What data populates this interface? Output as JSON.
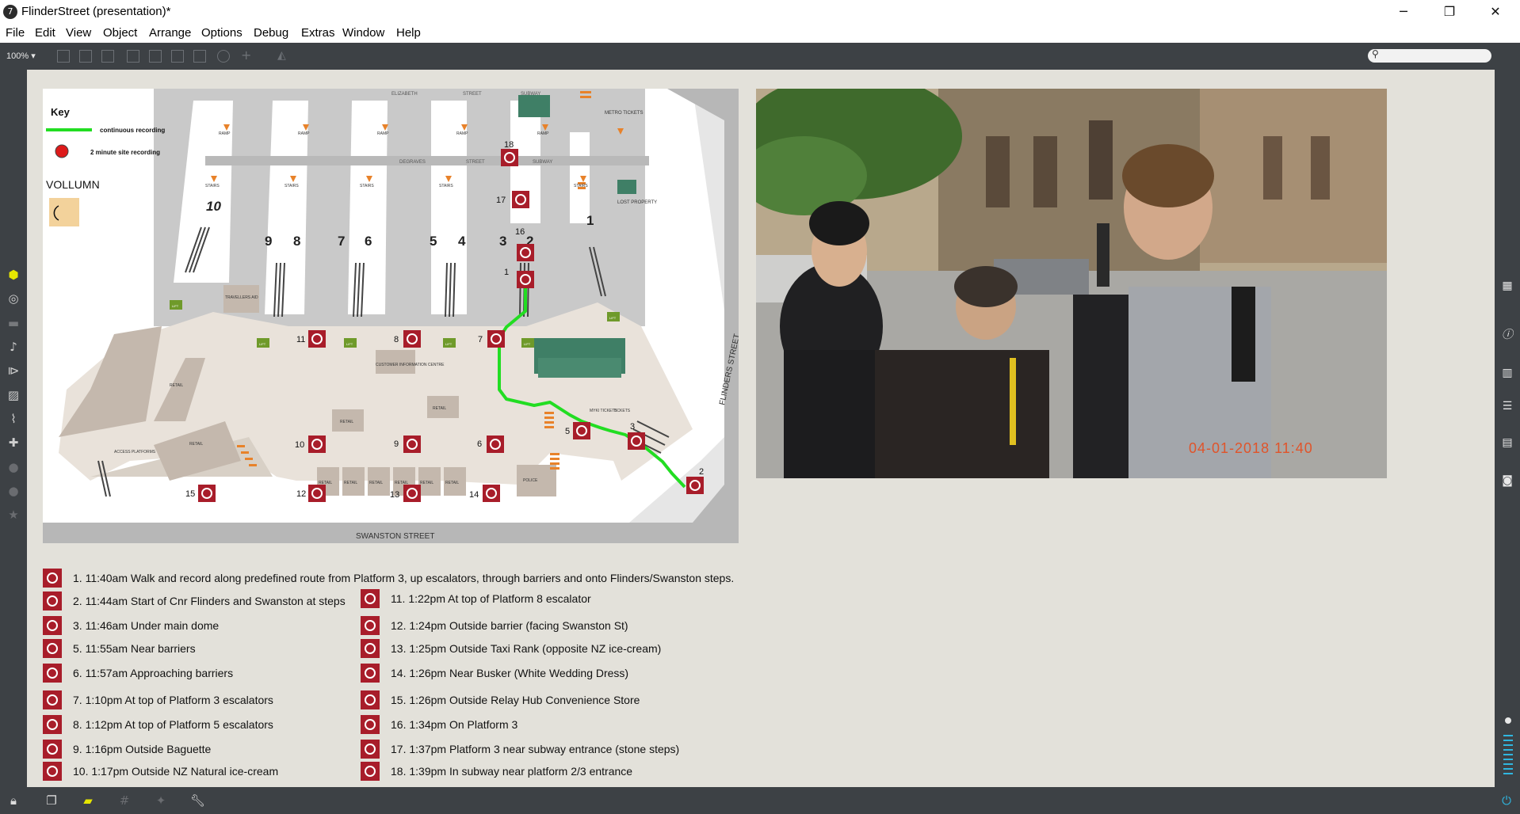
{
  "window": {
    "title": "FlinderStreet (presentation)*",
    "app_icon": "7",
    "minimize": "─",
    "restore": "❐",
    "close": "✕"
  },
  "menu": [
    "File",
    "Edit",
    "View",
    "Object",
    "Arrange",
    "Options",
    "Debug",
    "Extras",
    "Window",
    "Help"
  ],
  "toolbar": {
    "zoom": "100% ▾"
  },
  "map": {
    "key_title": "Key",
    "key_continuous": "continuous recording",
    "key_site": "2 minute site recording",
    "vollumn": "VOLLUMN",
    "street_bottom": "SWANSTON STREET",
    "street_right": "FLINDERS STREET",
    "street_top_1": "ELIZABETH",
    "street_top_2": "STREET",
    "subway": "SUBWAY",
    "platforms": [
      "10",
      "9",
      "8",
      "7",
      "6",
      "5",
      "4",
      "3",
      "2",
      "1"
    ],
    "markers": [
      "1",
      "2",
      "3",
      "5",
      "6",
      "7",
      "8",
      "9",
      "10",
      "11",
      "12",
      "13",
      "14",
      "15",
      "16",
      "17",
      "18"
    ],
    "labels": {
      "ramp": "RAMP",
      "stairs": "STAIRS",
      "lift": "LIFT",
      "retail": "RETAIL",
      "customer": "CUSTOMER INFORMATION CENTRE",
      "travellers_aid": "TRAVELLERS AID",
      "lost_property": "LOST PROPERTY",
      "metro_tickets": "METRO TICKETS",
      "police": "POLICE",
      "degraves": "DEGRAVES",
      "street": "STREET",
      "myki": "MYKI TICKETS",
      "tickets": "TICKETS",
      "access": "ACCESS PLATFORMS"
    }
  },
  "photo": {
    "timestamp": "04-01-2018 11:40"
  },
  "legend_col1": [
    "1. 11:40am Walk and record along predefined route from Platform 3, up escalators, through barriers and onto Flinders/Swanston steps.",
    "2. 11:44am Start of Cnr Flinders and Swanston at steps",
    "3. 11:46am Under main dome",
    "5. 11:55am Near barriers",
    "6. 11:57am Approaching barriers",
    "7. 1:10pm At top of Platform 3 escalators",
    "8. 1:12pm At top of Platform 5 escalators",
    "9. 1:16pm Outside Baguette",
    "10. 1:17pm Outside NZ Natural ice-cream"
  ],
  "legend_col2": [
    "11. 1:22pm At top of Platform 8 escalator",
    "12. 1:24pm Outside barrier (facing Swanston St)",
    "13. 1:25pm Outside Taxi Rank (opposite NZ ice-cream)",
    "14. 1:26pm Near Busker (White Wedding Dress)",
    "15. 1:26pm Outside Relay Hub Convenience Store",
    "16. 1:34pm On Platform 3",
    "17. 1:37pm Platform 3 near subway entrance (stone steps)",
    "18. 1:39pm In subway near platform 2/3 entrance"
  ],
  "colors": {
    "route": "#22dd22",
    "marker": "#a81d2a",
    "canvas": "#e3e1da",
    "chrome": "#3d4145",
    "stamp": "#e0542a"
  }
}
